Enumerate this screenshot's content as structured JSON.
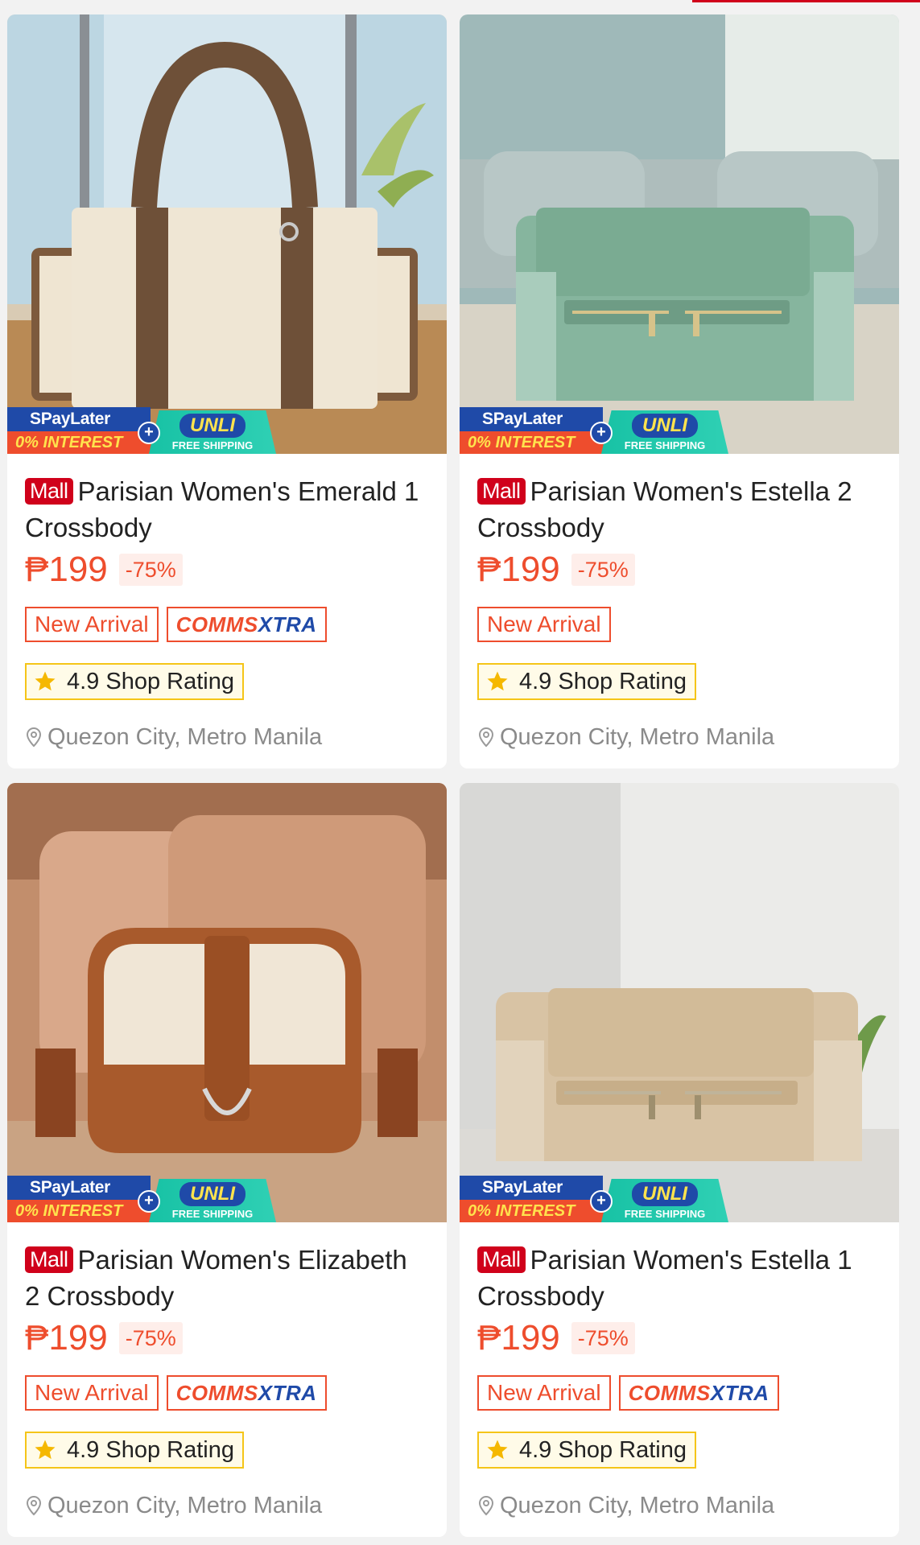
{
  "colors": {
    "brand_red": "#d0011b",
    "price_orange": "#ee4d2d",
    "rating_border": "#f5c518",
    "paylater_blue": "#1f4aa8",
    "unli_teal": "#18c2a5"
  },
  "promo": {
    "paylater": "SPayLater",
    "interest": "0% INTEREST",
    "plus": "+",
    "unli": "UNLI",
    "free_shipping": "FREE SHIPPING"
  },
  "products": [
    {
      "mall": "Mall",
      "title": "Parisian Women's Emerald 1 Crossbody",
      "price": "₱199",
      "discount": "-75%",
      "tag_new": "New Arrival",
      "comms_1": "COMMS",
      "comms_2": "XTRA",
      "rating": "4.9 Shop Rating",
      "location": "Quezon City, Metro Manila",
      "image_icon": "tote-bag-cream-brown"
    },
    {
      "mall": "Mall",
      "title": "Parisian Women's Estella 2 Crossbody",
      "price": "₱199",
      "discount": "-75%",
      "tag_new": "New Arrival",
      "rating": "4.9 Shop Rating",
      "location": "Quezon City, Metro Manila",
      "image_icon": "crossbody-bag-sage-green"
    },
    {
      "mall": "Mall",
      "title": "Parisian Women's Elizabeth 2 Crossbody",
      "price": "₱199",
      "discount": "-75%",
      "tag_new": "New Arrival",
      "comms_1": "COMMS",
      "comms_2": "XTRA",
      "rating": "4.9 Shop Rating",
      "location": "Quezon City, Metro Manila",
      "image_icon": "saddle-bag-brown-cream"
    },
    {
      "mall": "Mall",
      "title": "Parisian Women's Estella 1 Crossbody",
      "price": "₱199",
      "discount": "-75%",
      "tag_new": "New Arrival",
      "comms_1": "COMMS",
      "comms_2": "XTRA",
      "rating": "4.9 Shop Rating",
      "location": "Quezon City, Metro Manila",
      "image_icon": "crossbody-bag-beige"
    }
  ]
}
